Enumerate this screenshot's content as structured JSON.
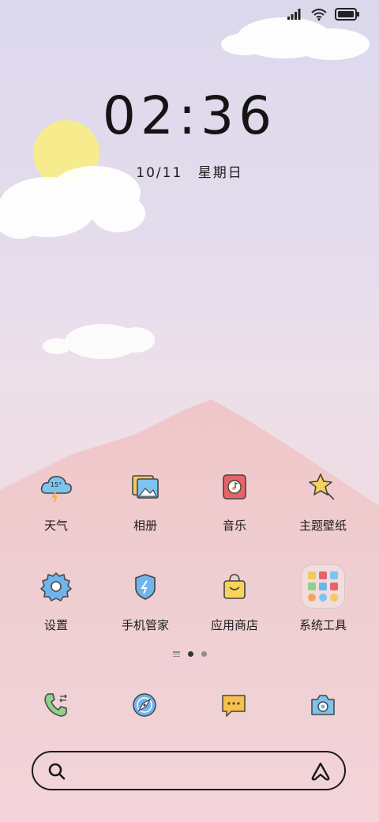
{
  "clock": {
    "time": "02:36"
  },
  "date": {
    "day": "10/11",
    "weekday": "星期日"
  },
  "status_bar": {
    "icons": [
      "signal-icon",
      "wifi-icon",
      "battery-icon"
    ]
  },
  "apps": [
    {
      "label": "天气",
      "icon": "weather-icon",
      "temp": "15°"
    },
    {
      "label": "相册",
      "icon": "gallery-icon"
    },
    {
      "label": "音乐",
      "icon": "music-icon"
    },
    {
      "label": "主题壁纸",
      "icon": "themes-icon"
    },
    {
      "label": "设置",
      "icon": "settings-icon"
    },
    {
      "label": "手机管家",
      "icon": "phone-manager-icon"
    },
    {
      "label": "应用商店",
      "icon": "app-store-icon"
    },
    {
      "label": "系统工具",
      "icon": "system-tools-folder-icon"
    }
  ],
  "page_indicator": {
    "pages": 2,
    "active": 1
  },
  "dock": [
    "phone-icon",
    "browser-icon",
    "messages-icon",
    "camera-icon"
  ],
  "search_bar": {
    "left_icon": "search-icon",
    "right_icon": "assistant-icon"
  }
}
